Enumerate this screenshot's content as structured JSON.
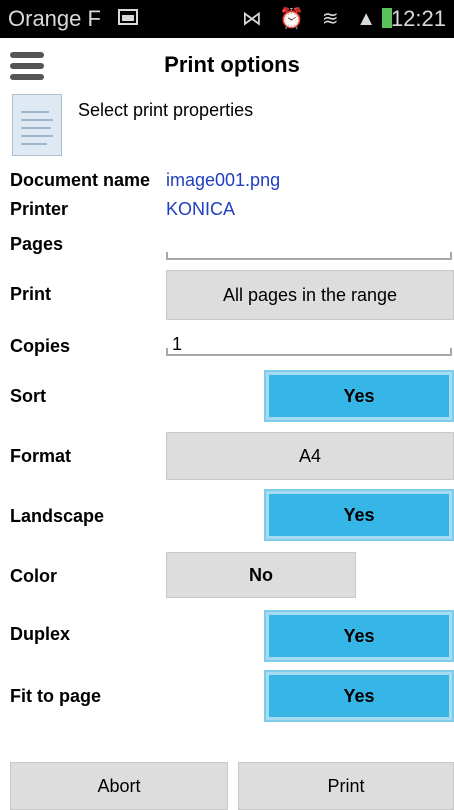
{
  "status_bar": {
    "carrier": "Orange F",
    "icons": "⋈ ⏰ ≋ ▲",
    "time": "12:21"
  },
  "header": {
    "title": "Print options"
  },
  "intro": {
    "subtitle": "Select print properties"
  },
  "document": {
    "label": "Document name",
    "value": "image001.png"
  },
  "printer": {
    "label": "Printer",
    "value": "KONICA"
  },
  "pages": {
    "label": "Pages",
    "value": ""
  },
  "print": {
    "label": "Print",
    "value": "All pages in the range"
  },
  "copies": {
    "label": "Copies",
    "value": "1"
  },
  "sort": {
    "label": "Sort",
    "value": "Yes"
  },
  "format": {
    "label": "Format",
    "value": "A4"
  },
  "landscape": {
    "label": "Landscape",
    "value": "Yes"
  },
  "color": {
    "label": "Color",
    "value": "No"
  },
  "duplex": {
    "label": "Duplex",
    "value": "Yes"
  },
  "fit": {
    "label": "Fit to page",
    "value": "Yes"
  },
  "actions": {
    "abort": "Abort",
    "print": "Print"
  },
  "colors": {
    "toggle_on": "#35b6e6",
    "link": "#1f3fbf",
    "button_gray": "#dddddd"
  }
}
